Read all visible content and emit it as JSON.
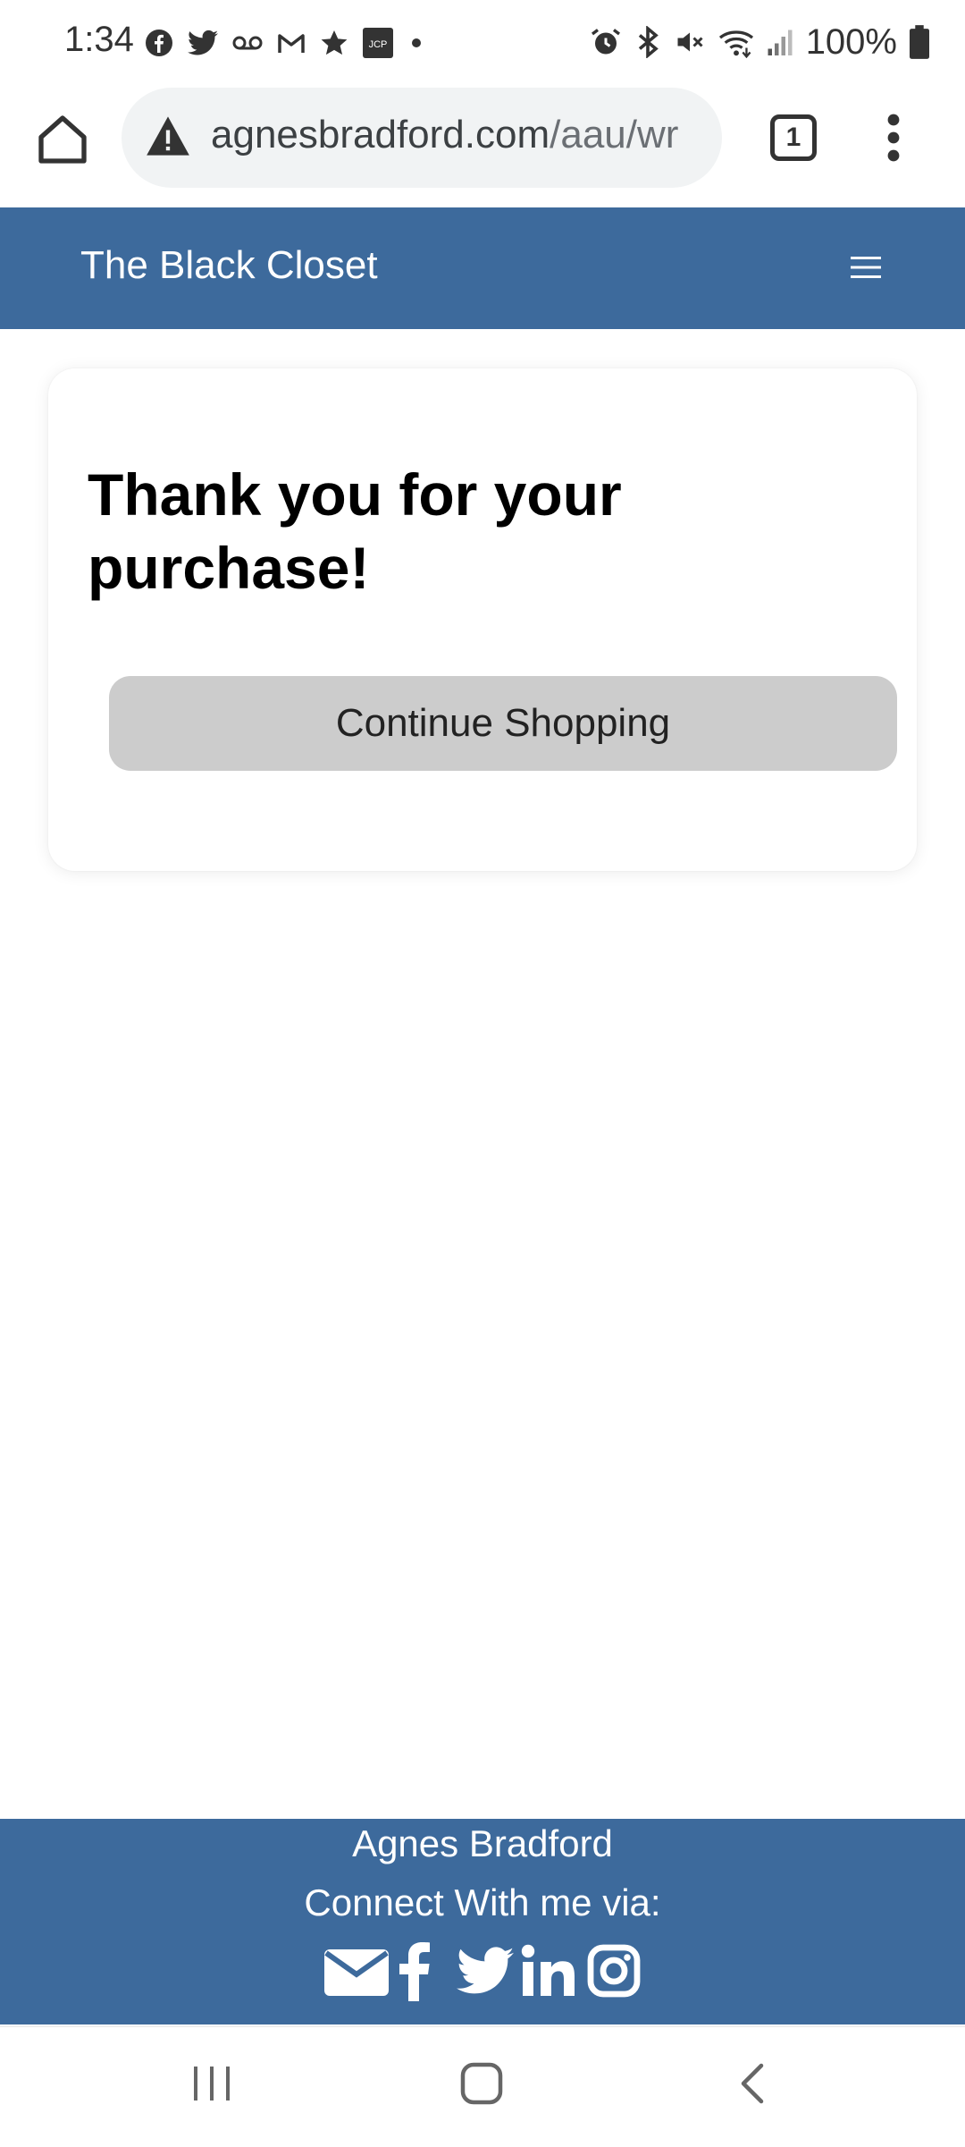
{
  "status_bar": {
    "time": "1:34",
    "left_icons": [
      "facebook-icon",
      "twitter-icon",
      "voicemail-icon",
      "gmail-icon",
      "star-icon",
      "jcp-icon",
      "dot-icon"
    ],
    "jcp_label": "JCP",
    "right_icons": [
      "alarm-icon",
      "bluetooth-icon",
      "mute-icon",
      "wifi-icon",
      "signal-icon",
      "battery-icon"
    ],
    "battery_percent": "100%"
  },
  "browser": {
    "url_domain": "agnesbradford.com",
    "url_path": "/aau/wr",
    "tab_count": "1"
  },
  "site": {
    "brand": "The Black Closet",
    "colors": {
      "primary": "#3d6a9c",
      "button": "#cccccc"
    }
  },
  "card": {
    "heading": "Thank you for your purchase!",
    "button_label": "Continue Shopping"
  },
  "footer": {
    "name": "Agnes Bradford",
    "connect": "Connect With me via:",
    "social_icons": [
      "email-icon",
      "facebook-icon",
      "twitter-icon",
      "linkedin-icon",
      "instagram-icon"
    ]
  },
  "system_nav": [
    "recent-apps-icon",
    "home-icon",
    "back-icon"
  ]
}
